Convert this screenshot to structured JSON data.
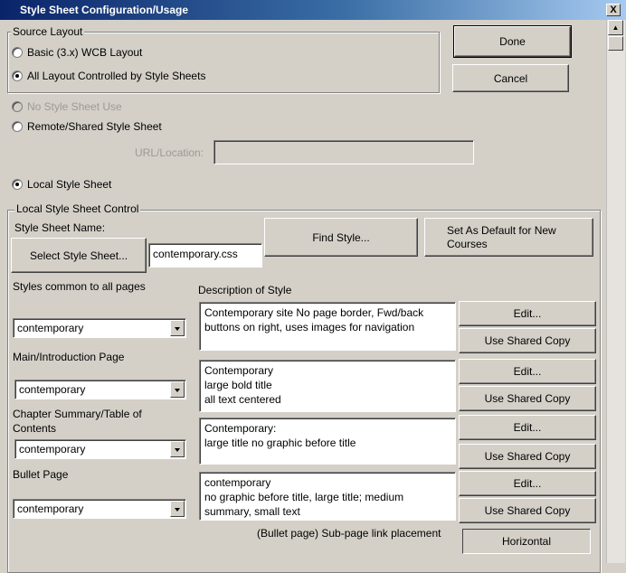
{
  "window": {
    "title": "Style Sheet Configuration/Usage",
    "close_glyph": "X"
  },
  "source_layout": {
    "legend": "Source Layout",
    "options": [
      "Basic (3.x) WCB Layout",
      "All Layout Controlled by Style Sheets"
    ],
    "selected": 1
  },
  "buttons": {
    "done": "Done",
    "cancel": "Cancel"
  },
  "usage": {
    "no_style_sheet": "No Style Sheet Use",
    "remote_shared": "Remote/Shared Style Sheet",
    "url_label": "URL/Location:",
    "url_value": "",
    "local": "Local Style Sheet"
  },
  "local_control": {
    "legend": "Local Style Sheet Control",
    "name_label": "Style Sheet Name:",
    "select_button": "Select Style Sheet...",
    "filename": "contemporary.css",
    "find_style": "Find Style...",
    "set_default": "Set As Default for New Courses",
    "description_header": "Description of Style"
  },
  "styles": [
    {
      "label": "Styles common to all pages",
      "value": "contemporary",
      "description": "Contemporary site No page border, Fwd/back\nbuttons on right, uses images for navigation",
      "edit": "Edit...",
      "shared": "Use Shared Copy"
    },
    {
      "label": "Main/Introduction Page",
      "value": "contemporary",
      "description": "Contemporary\nlarge bold title\nall text centered",
      "edit": "Edit...",
      "shared": "Use Shared Copy"
    },
    {
      "label": "Chapter Summary/Table of Contents",
      "value": "contemporary",
      "description": "Contemporary:\nlarge title no graphic before title",
      "edit": "Edit...",
      "shared": "Use Shared Copy"
    },
    {
      "label": "Bullet Page",
      "value": "contemporary",
      "description": "contemporary\nno graphic before title, large title; medium\nsummary, small text",
      "edit": "Edit...",
      "shared": "Use Shared Copy"
    }
  ],
  "subpage": {
    "label": "(Bullet page) Sub-page link placement",
    "value": "Horizontal"
  },
  "icons": {
    "close": "close-icon",
    "radio": "radio-icon",
    "dropdown": "chevron-down-icon",
    "scroll_up": "scroll-up-icon"
  }
}
